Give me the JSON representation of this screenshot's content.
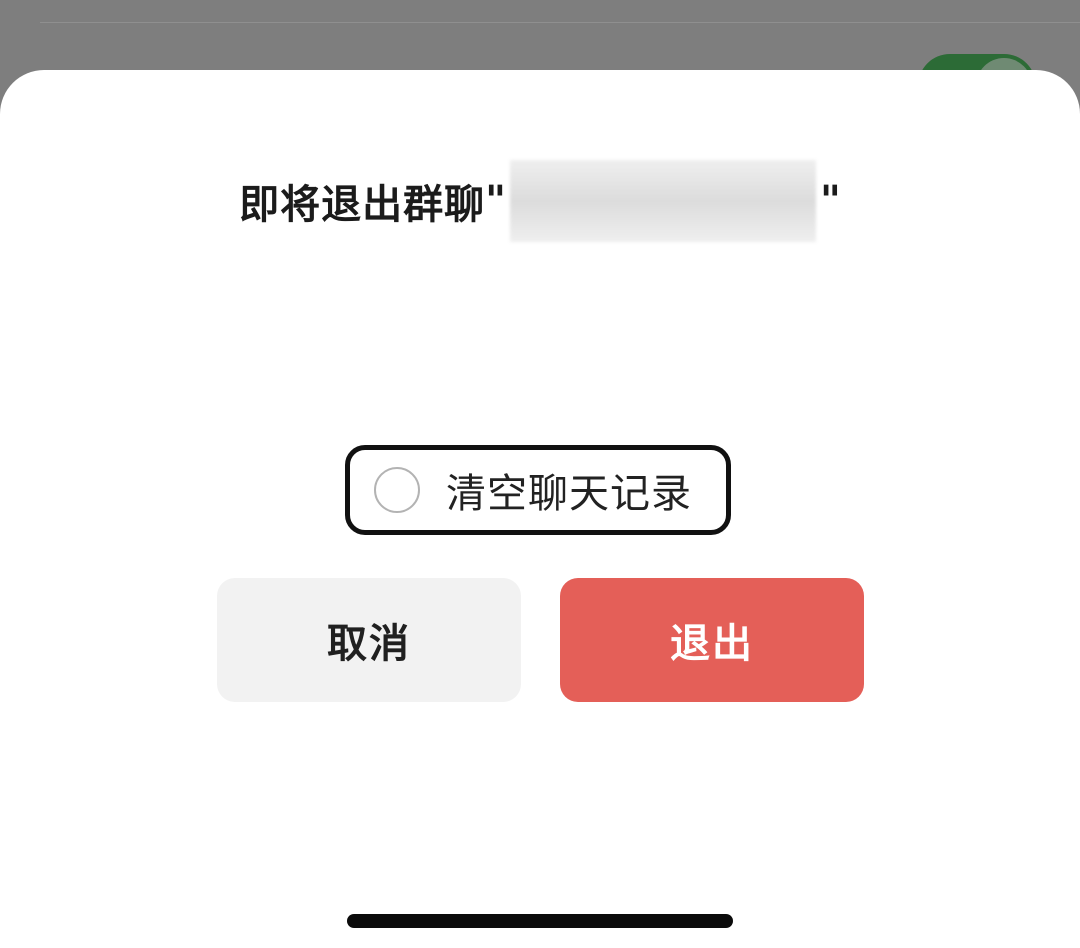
{
  "dialog": {
    "title_prefix": "即将退出群聊",
    "quote_open": "\"",
    "quote_close": "\"",
    "clear_history_label": "清空聊天记录",
    "clear_history_checked": false
  },
  "buttons": {
    "cancel_label": "取消",
    "exit_label": "退出"
  },
  "colors": {
    "exit_button": "#e45f58",
    "cancel_button": "#f2f2f2",
    "overlay": "#7e7e7e",
    "toggle_on": "#2c6b36"
  },
  "icons": {
    "radio": "radio-unchecked-icon"
  }
}
